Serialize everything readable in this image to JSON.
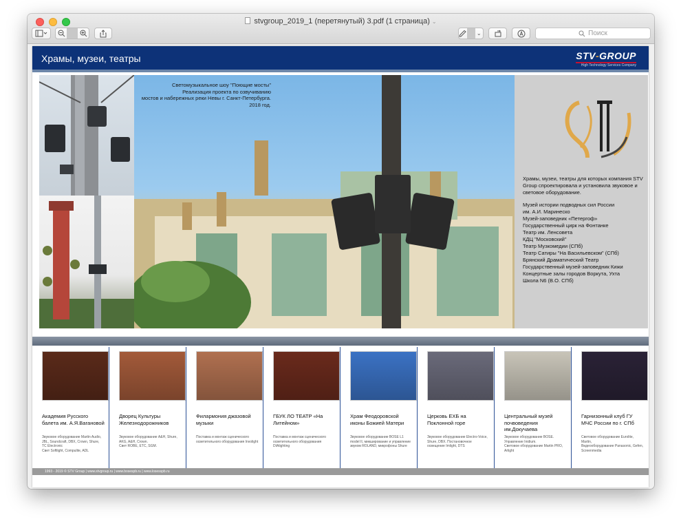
{
  "window": {
    "title": "stvgroup_2019_1 (перетянутый) 3.pdf (1 страница)",
    "search_placeholder": "Поиск"
  },
  "header": {
    "title": "Храмы, музеи, театры",
    "logo_main": "STV",
    "logo_accent": "GROUP",
    "logo_tagline": "High Technology Services Company"
  },
  "hero": {
    "caption": [
      "Светомузыкальное шоу \"Поющие мосты\"",
      "Реализация проекта по озвучиванию",
      "мостов и набережных реки Невы г. Санкт-Петербурга.",
      "2018 год."
    ]
  },
  "right_panel": {
    "intro": "Храмы, музеи, театры для которых компания STV Group спроектировала и установила звуковое и световое оборудование.",
    "list": [
      "Музей истории подводных сил России",
      "им. А.И. Маринеско",
      "Музей-заповедник «Петергоф»",
      "Государственный цирк на Фонтанке",
      "Театр им. Ленсовета",
      "КДЦ \"Московский\"",
      "Театр Музкомедии (СПб)",
      "Театр Сатиры \"На Васильевском\" (СПб)",
      "Брянский Драматический Театр",
      "Государственный музей-заповедник Кижи",
      "Концертные залы городов Воркута, Ухта",
      "Школа N6 (В.О. СПб)"
    ]
  },
  "cards": [
    {
      "title": "Академия Русского балета им. А.Я.Вагановой",
      "desc": "Звуковое оборудование Martin Audio, JBL, Soundcraft, DBX, Crown, Shure, TC Electronic\nСвет Softlight, Compulite, ADL",
      "bg": "#5a2a1a"
    },
    {
      "title": "Дворец Культуры Железнодорожников",
      "desc": "Звуковое оборудование A&H, Shure, AKG, A&H, Crown.\nСвет ROBE, ETC, SGM.",
      "bg": "#a35a3a"
    },
    {
      "title": "Филармония джазовой музыки",
      "desc": "Поставка и монтаж сценического осветительного оборудования Involight",
      "bg": "#b07050"
    },
    {
      "title": "ГБУК ЛО ТЕАТР «На Литейном»",
      "desc": "Поставка и монтаж сценического осветительного оборудования DIAlighting",
      "bg": "#6a2a1c"
    },
    {
      "title": "Храм Феодоровской иконы Божией Матери",
      "desc": "Звуковое оборудование BOSE L1 model II, микширование и управление звуком ROLAND, микрофоны Shure",
      "bg": "#3b72c4"
    },
    {
      "title": "Церковь ЕХБ на Поклонной горе",
      "desc": "Звуковое оборудование Electro-Voice, Shure, DBX. Постановочное освещение Imlight, DTS",
      "bg": "#6a6a7a"
    },
    {
      "title": "Центральный музей почвоведения им.Докучаева",
      "desc": "Звуковое оборудование BOSE. Управление Inidium.\nСветовое оборудование Martin PRO, Arlight",
      "bg": "#c8c4b8"
    },
    {
      "title": "Гарнизонный клуб ГУ МЧС России по г. СПб",
      "desc": "Световое оборудование Eurolite, Martin,\nВидеооборудование Panasonic, Gefen, Screenmedia",
      "bg": "#2a2236"
    }
  ],
  "footer": {
    "text": "1993 - 2019 © STV Group | www.stvgroup.ru | www.bosespb.ru | www.losesspb.ru"
  }
}
